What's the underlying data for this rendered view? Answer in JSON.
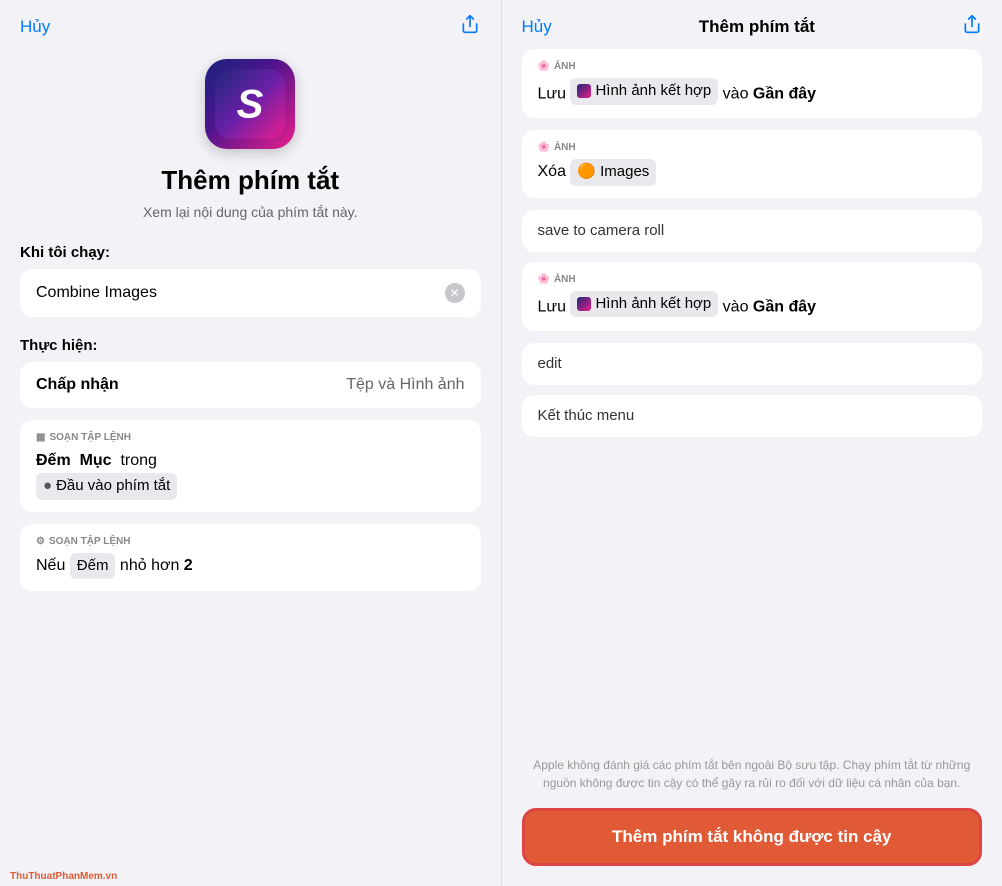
{
  "left": {
    "cancel_btn": "Hủy",
    "share_icon": "↑",
    "app_icon_letter": "S",
    "title": "Thêm phím tắt",
    "subtitle": "Xem lại nội dung của phím tắt này.",
    "when_label": "Khi tôi chạy:",
    "shortcut_name": "Combine Images",
    "do_label": "Thực hiện:",
    "accept_label": "Chấp nhận",
    "accept_value": "Tệp và Hình ảnh",
    "card1_badge": "SOẠN TẬP LỆNH",
    "card1_badge_icon": "▦",
    "card1_line1": "Đếm  Mục  trong",
    "card1_tag": "Đầu vào phím tắt",
    "card1_tag_icon": "●",
    "card2_badge": "SOẠN TẬP LỆNH",
    "card2_badge_icon": "⚙",
    "card2_line1": "Nếu",
    "card2_tag": "Đếm",
    "card2_line2": "nhỏ hơn",
    "card2_num": "2",
    "watermark": "ThuThuatPhanMem.vn"
  },
  "right": {
    "cancel_btn": "Hủy",
    "title": "Thêm phím tắt",
    "share_icon": "↑",
    "card1_badge": "ẢNH",
    "card1_badge_icon": "🌸",
    "card1_line": "Lưu",
    "card1_shortcuts_tag": "Hình ảnh kết hợp",
    "card1_text2": "vào",
    "card1_text3": "Gần đây",
    "card2_badge": "ẢNH",
    "card2_badge_icon": "🌸",
    "card2_line1": "Xóa",
    "card2_tag": "Images",
    "card2_tag_icon": "🟠",
    "simple1": "save to camera roll",
    "card3_badge": "ẢNH",
    "card3_badge_icon": "🌸",
    "card3_line": "Lưu",
    "card3_shortcuts_tag": "Hình ảnh kết hợp",
    "card3_text2": "vào",
    "card3_text3": "Gần đây",
    "simple2": "edit",
    "simple3": "Kết thúc menu",
    "disclaimer": "Apple không đánh giá các phím tắt bên ngoài Bộ sưu tập. Chạy phím tắt từ những nguồn không được tin cậy có thể gây ra rủi ro đối với dữ liệu cá nhân của bạn.",
    "action_btn": "Thêm phím tắt không được tin cậy"
  }
}
